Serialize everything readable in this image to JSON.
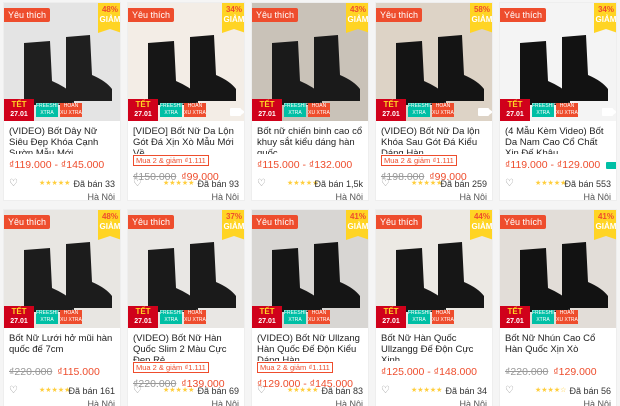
{
  "colors": {
    "accent": "#ee4d2d",
    "badge": "#ffd424",
    "freeship": "#00bfa5"
  },
  "labels": {
    "favorite": "Yêu thích",
    "discount_word": "GIẢM",
    "tet_title": "TẾT",
    "tet_date": "27.01",
    "freeship": "FREESHIP XTRA",
    "hoan_xu": "HOÀN XU XTRA"
  },
  "products": [
    {
      "name": "(VIDEO) Bốt Dây Nữ Siêu Đẹp Khóa Cạnh Sườn Mẫu Mới",
      "discount": "48%",
      "promo": "",
      "old_price": "",
      "price": "₫119.000 - ₫145.000",
      "sold": "Đã bán 33",
      "location": "Hà Nội",
      "video": false,
      "ship_icon": false,
      "bg": "#e4e4e4",
      "shoe": "#1f1f1f",
      "rating": 5
    },
    {
      "name": "[VIDEO] Bốt Nữ Da Lộn Gót Đá Xịn Xò Mẫu Mới Về",
      "discount": "34%",
      "promo": "Mua 2 & giảm ₫1.111",
      "old_price": "₫150.000",
      "price": "₫99.000",
      "sold": "Đã bán 93",
      "location": "Hà Nội",
      "video": true,
      "ship_icon": false,
      "bg": "#f3ede6",
      "shoe": "#161616",
      "rating": 5
    },
    {
      "name": "Bốt nữ chiến binh cao cổ khuy sắt kiểu dáng hàn quốc",
      "discount": "43%",
      "promo": "",
      "old_price": "",
      "price": "₫115.000 - ₫132.000",
      "sold": "Đã bán 1,5k",
      "location": "Hà Nội",
      "video": false,
      "ship_icon": false,
      "bg": "#c9c2b8",
      "shoe": "#1a1a1a",
      "rating": 5
    },
    {
      "name": "(VIDEO) Bốt Nữ Da lộn Khóa Sau Gót Đá Kiểu Dáng Hàn...",
      "discount": "58%",
      "promo": "Mua 2 & giảm ₫1.111",
      "old_price": "₫198.000",
      "price": "₫99.000",
      "sold": "Đã bán 259",
      "location": "Hà Nội",
      "video": true,
      "ship_icon": false,
      "bg": "#ddd3c6",
      "shoe": "#141414",
      "rating": 5
    },
    {
      "name": "(4 Mẫu Kèm Video) Bốt Da Nam Cao Cổ Chất Xịn Đế Khâu,...",
      "discount": "34%",
      "promo": "",
      "old_price": "",
      "price": "₫119.000 - ₫129.000",
      "sold": "Đã bán 553",
      "location": "Hà Nội",
      "video": true,
      "ship_icon": true,
      "bg": "#f4f4f4",
      "shoe": "#121212",
      "rating": 5
    },
    {
      "name": "Bốt Nữ Lưới hở mũi hàn quốc đế 7cm",
      "discount": "48%",
      "promo": "",
      "old_price": "₫220.000",
      "price": "₫115.000",
      "sold": "Đã bán 161",
      "location": "Hà Nội",
      "video": false,
      "ship_icon": false,
      "bg": "#e8e6e2",
      "shoe": "#1c1c1c",
      "rating": 5
    },
    {
      "name": "(VIDEO) Bốt Nữ Hàn Quốc Slim 2 Màu Cực Đẹp Rẻ",
      "discount": "37%",
      "promo": "Mua 2 & giảm ₫1.111",
      "old_price": "₫220.000",
      "price": "₫139.000",
      "sold": "Đã bán 69",
      "location": "Hà Nội",
      "video": false,
      "ship_icon": false,
      "bg": "#e9e7e4",
      "shoe": "#1a1a1a",
      "rating": 5
    },
    {
      "name": "(VIDEO) Bốt Nữ Ullzang Hàn Quốc Đế Độn Kiểu Dáng Hàn...",
      "discount": "41%",
      "promo": "Mua 2 & giảm ₫1.111",
      "old_price": "",
      "price": "₫129.000 - ₫145.000",
      "sold": "Đã bán 83",
      "location": "Hà Nội",
      "video": false,
      "ship_icon": false,
      "bg": "#d8d6d3",
      "shoe": "#151515",
      "rating": 5
    },
    {
      "name": "Bốt Nữ Hàn Quốc Ullzangg Đế Độn Cực Xinh",
      "discount": "44%",
      "promo": "",
      "old_price": "",
      "price": "₫125.000 - ₫148.000",
      "sold": "Đã bán 34",
      "location": "Hà Nội",
      "video": false,
      "ship_icon": false,
      "bg": "#ece9e4",
      "shoe": "#161616",
      "rating": 5
    },
    {
      "name": "Bốt Nữ Nhún Cao Cổ Hàn Quốc Xịn Xò",
      "discount": "41%",
      "promo": "",
      "old_price": "₫220.000",
      "price": "₫129.000",
      "sold": "Đã bán 56",
      "location": "Hà Nội",
      "video": false,
      "ship_icon": false,
      "bg": "#e2ddd8",
      "shoe": "#121212",
      "rating": 4
    }
  ]
}
